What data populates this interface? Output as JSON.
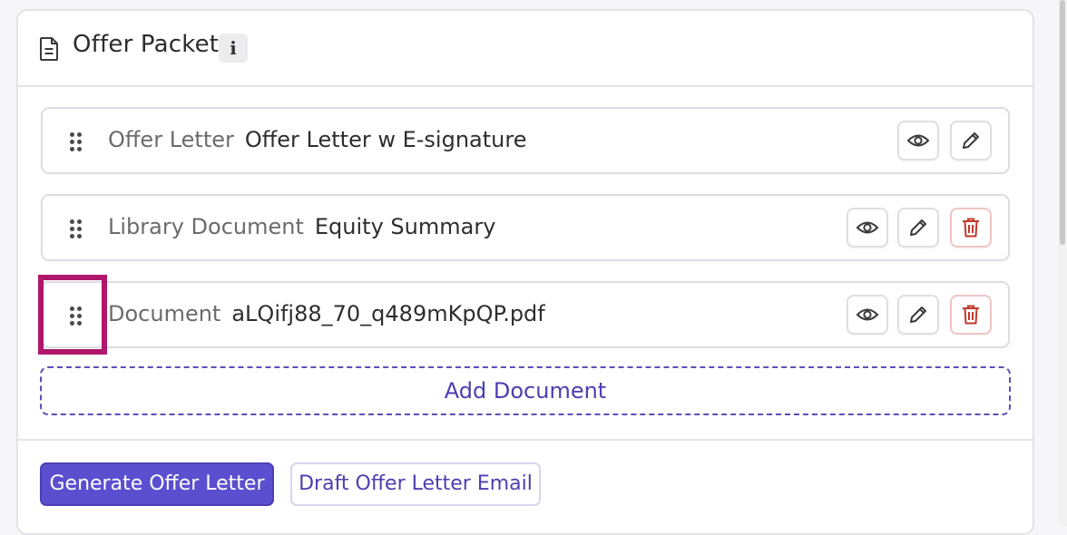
{
  "panel": {
    "title": "Offer Packet",
    "info_badge": "i"
  },
  "documents": [
    {
      "type": "Offer Letter",
      "name": "Offer Letter w E-signature",
      "actions": [
        "view",
        "edit"
      ]
    },
    {
      "type": "Library Document",
      "name": "Equity Summary",
      "actions": [
        "view",
        "edit",
        "delete"
      ]
    },
    {
      "type": "Document",
      "name": "aLQifj88_70_q489mKpQP.pdf",
      "actions": [
        "view",
        "edit",
        "delete"
      ]
    }
  ],
  "add_document_label": "Add Document",
  "footer": {
    "generate_label": "Generate Offer Letter",
    "draft_email_label": "Draft Offer Letter Email"
  },
  "colors": {
    "accent": "#5b4fcf",
    "highlight": "#b0176a",
    "danger": "#c0392b"
  },
  "icons": {
    "header": "document-icon",
    "view": "eye-icon",
    "edit": "pencil-icon",
    "delete": "trash-icon",
    "drag": "drag-handle-icon"
  }
}
